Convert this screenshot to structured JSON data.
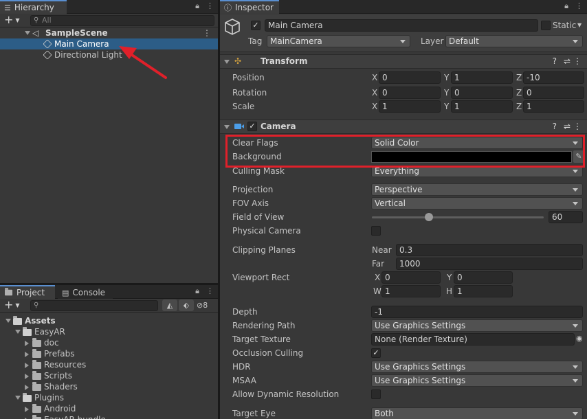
{
  "hierarchy": {
    "tab_label": "Hierarchy",
    "search_placeholder": "All",
    "scene": "SampleScene",
    "items": [
      "Main Camera",
      "Directional Light"
    ]
  },
  "project": {
    "tabs": [
      "Project",
      "Console"
    ],
    "hidden_count": "8",
    "tree": [
      {
        "label": "Assets",
        "depth": 0,
        "open": true,
        "bold": true
      },
      {
        "label": "EasyAR",
        "depth": 1,
        "open": true
      },
      {
        "label": "doc",
        "depth": 2
      },
      {
        "label": "Prefabs",
        "depth": 2
      },
      {
        "label": "Resources",
        "depth": 2
      },
      {
        "label": "Scripts",
        "depth": 2
      },
      {
        "label": "Shaders",
        "depth": 2
      },
      {
        "label": "Plugins",
        "depth": 1,
        "open": true
      },
      {
        "label": "Android",
        "depth": 2
      },
      {
        "label": "EasyAR bundle",
        "depth": 2
      }
    ]
  },
  "inspector": {
    "tab_label": "Inspector",
    "object_name": "Main Camera",
    "static_label": "Static",
    "tag_label": "Tag",
    "tag_value": "MainCamera",
    "layer_label": "Layer",
    "layer_value": "Default",
    "transform": {
      "title": "Transform",
      "rows": [
        {
          "label": "Position",
          "x": "0",
          "y": "1",
          "z": "-10"
        },
        {
          "label": "Rotation",
          "x": "0",
          "y": "0",
          "z": "0"
        },
        {
          "label": "Scale",
          "x": "1",
          "y": "1",
          "z": "1"
        }
      ]
    },
    "camera": {
      "title": "Camera",
      "clear_flags_label": "Clear Flags",
      "clear_flags_value": "Solid Color",
      "background_label": "Background",
      "background_color": "#000000",
      "culling_mask_label": "Culling Mask",
      "culling_mask_value": "Everything",
      "projection_label": "Projection",
      "projection_value": "Perspective",
      "fov_axis_label": "FOV Axis",
      "fov_axis_value": "Vertical",
      "fov_label": "Field of View",
      "fov_value": "60",
      "fov_fraction": 0.33,
      "physical_label": "Physical Camera",
      "clipping_label": "Clipping Planes",
      "near_label": "Near",
      "near_value": "0.3",
      "far_label": "Far",
      "far_value": "1000",
      "viewport_label": "Viewport Rect",
      "vp_x": "0",
      "vp_y": "0",
      "vp_w": "1",
      "vp_h": "1",
      "depth_label": "Depth",
      "depth_value": "-1",
      "rendering_path_label": "Rendering Path",
      "rendering_path_value": "Use Graphics Settings",
      "target_texture_label": "Target Texture",
      "target_texture_value": "None (Render Texture)",
      "occlusion_label": "Occlusion Culling",
      "hdr_label": "HDR",
      "hdr_value": "Use Graphics Settings",
      "msaa_label": "MSAA",
      "msaa_value": "Use Graphics Settings",
      "dyn_res_label": "Allow Dynamic Resolution",
      "target_eye_label": "Target Eye",
      "target_eye_value": "Both"
    },
    "axis_x": "X",
    "axis_y": "Y",
    "axis_z": "Z",
    "axis_w": "W",
    "axis_h": "H"
  },
  "colors": {
    "annotation_red": "#e0202a",
    "selection_blue": "#2c5d87"
  }
}
